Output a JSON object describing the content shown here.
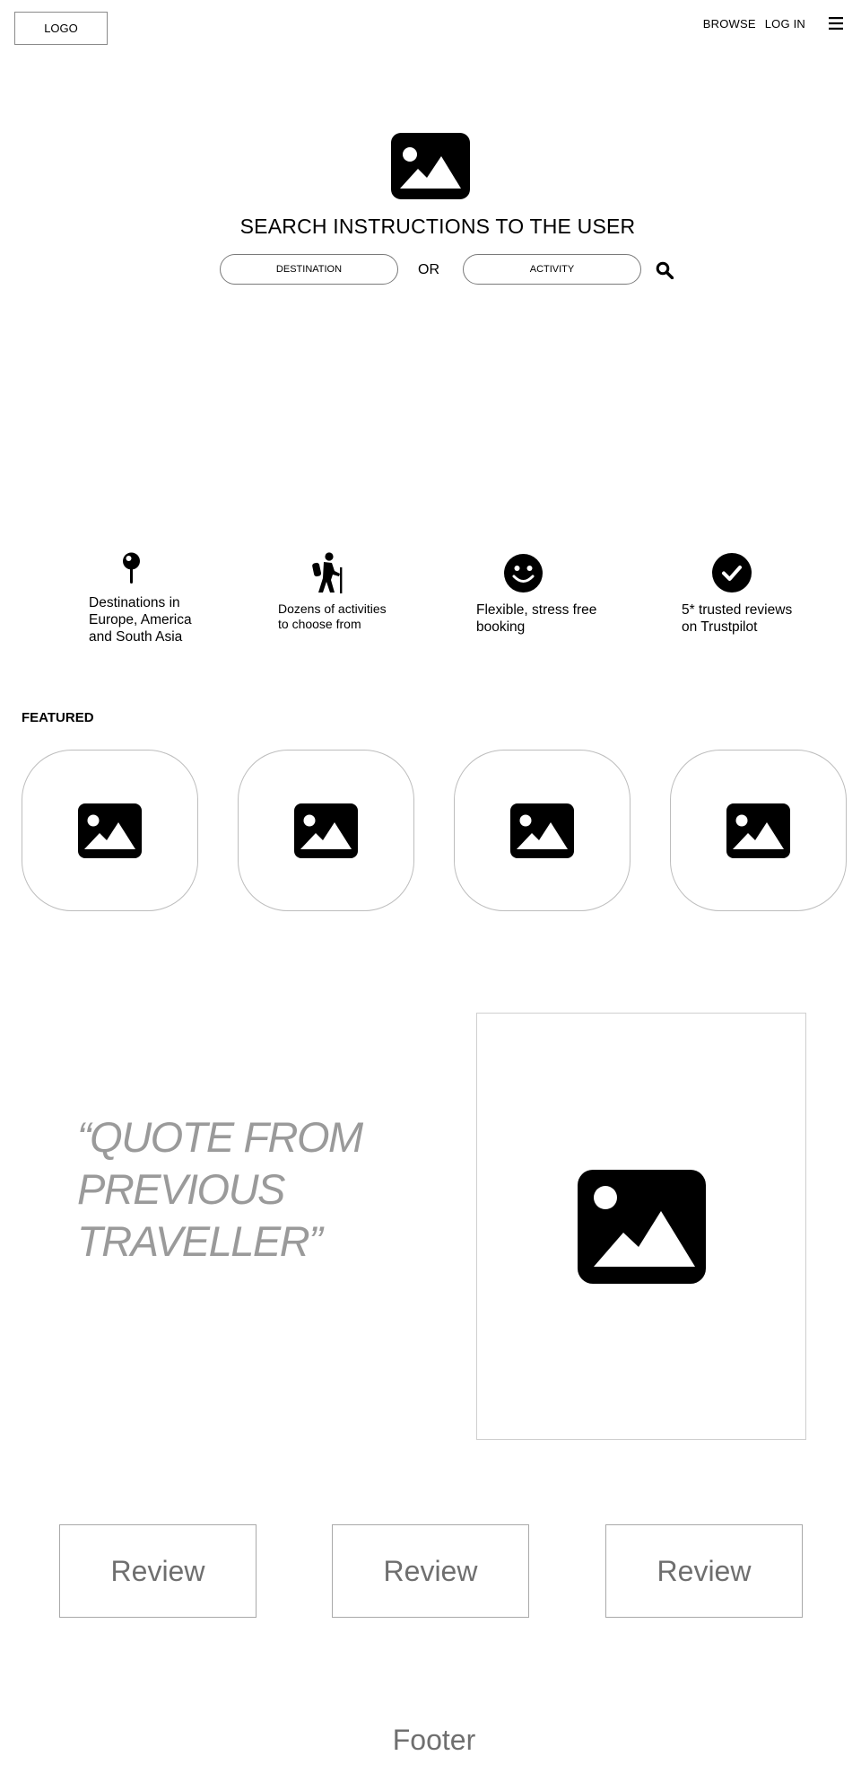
{
  "header": {
    "logo_label": "LOGO",
    "nav": {
      "browse": "BROWSE",
      "login": "LOG IN"
    },
    "menu_icon": "hamburger-menu-icon"
  },
  "hero": {
    "image_icon": "image-placeholder-icon",
    "title": "SEARCH INSTRUCTIONS TO THE USER",
    "destination_placeholder": "DESTINATION",
    "or_label": "OR",
    "activity_placeholder": "ACTIVITY",
    "search_icon": "search-icon"
  },
  "features": [
    {
      "icon": "map-pin-icon",
      "text": "Destinations in\nEurope, America\nand South Asia"
    },
    {
      "icon": "hiker-icon",
      "text": "Dozens of activities\nto choose from"
    },
    {
      "icon": "smiley-icon",
      "text": "Flexible, stress free\nbooking"
    },
    {
      "icon": "check-circle-icon",
      "text": "5* trusted reviews\non Trustpilot"
    }
  ],
  "featured": {
    "title": "FEATURED",
    "cards": [
      {
        "icon": "image-placeholder-icon"
      },
      {
        "icon": "image-placeholder-icon"
      },
      {
        "icon": "image-placeholder-icon"
      },
      {
        "icon": "image-placeholder-icon"
      }
    ]
  },
  "testimonial": {
    "quote": "“QUOTE FROM\nPREVIOUS\nTRAVELLER”",
    "image_icon": "image-placeholder-icon"
  },
  "reviews": [
    {
      "label": "Review"
    },
    {
      "label": "Review"
    },
    {
      "label": "Review"
    }
  ],
  "footer": {
    "label": "Footer"
  }
}
